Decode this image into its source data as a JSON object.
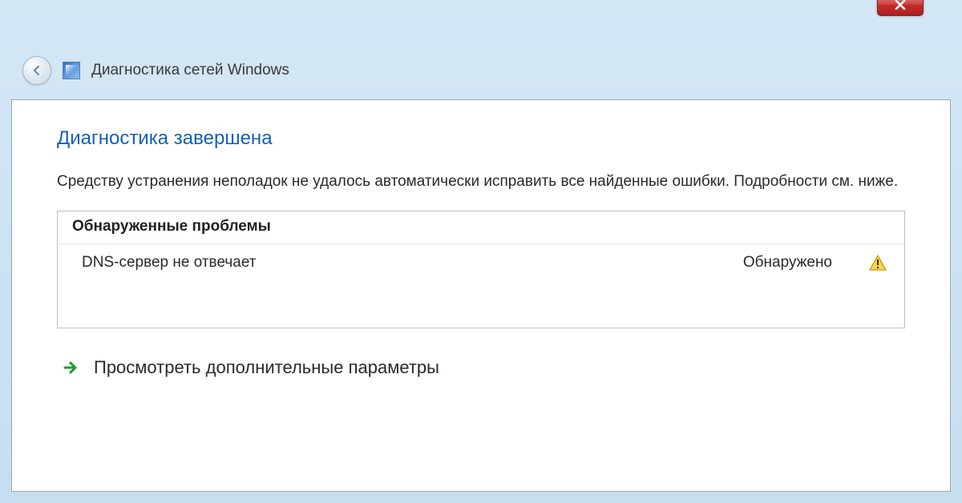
{
  "window": {
    "title": "Диагностика сетей Windows"
  },
  "dialog": {
    "heading": "Диагностика завершена",
    "description": "Средству устранения неполадок не удалось автоматически исправить все найденные ошибки. Подробности см. ниже.",
    "problems_header": "Обнаруженные проблемы",
    "problems": [
      {
        "name": "DNS-сервер не отвечает",
        "status": "Обнаружено"
      }
    ],
    "link": "Просмотреть дополнительные параметры"
  }
}
